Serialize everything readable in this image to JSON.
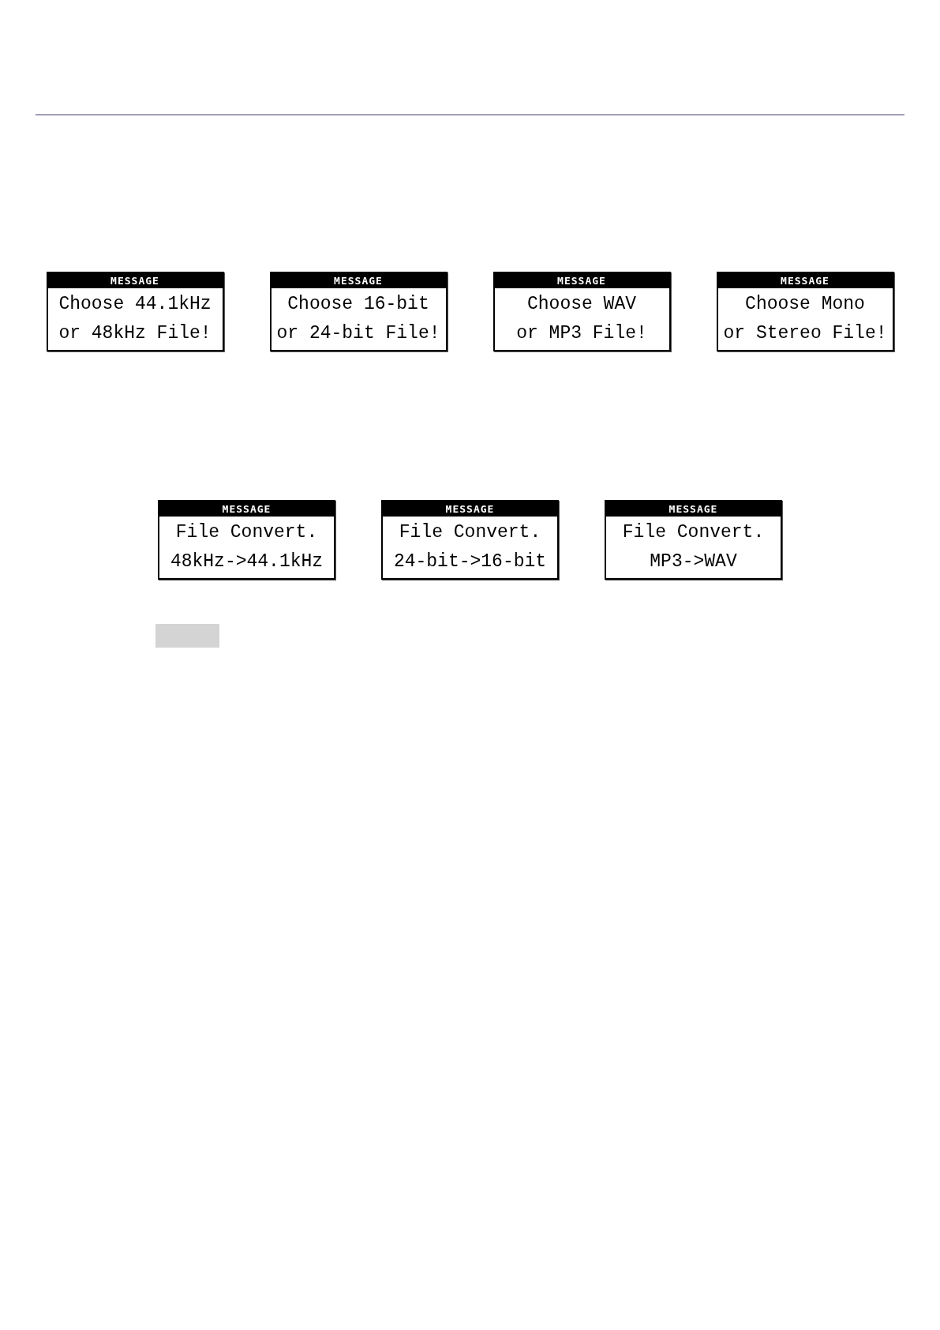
{
  "choice_messages": [
    {
      "title": "MESSAGE",
      "lines": [
        "Choose 44.1kHz",
        "or 48kHz File!"
      ]
    },
    {
      "title": "MESSAGE",
      "lines": [
        "Choose 16-bit",
        "or 24-bit File!"
      ]
    },
    {
      "title": "MESSAGE",
      "lines": [
        "Choose WAV",
        "or MP3 File!"
      ]
    },
    {
      "title": "MESSAGE",
      "lines": [
        "Choose Mono",
        "or Stereo File!"
      ]
    }
  ],
  "convert_messages": [
    {
      "title": "MESSAGE",
      "lines": [
        "File Convert.",
        "48kHz->44.1kHz"
      ]
    },
    {
      "title": "MESSAGE",
      "lines": [
        "File Convert.",
        "24-bit->16-bit"
      ]
    },
    {
      "title": "MESSAGE",
      "lines": [
        "File Convert.",
        "MP3->WAV"
      ]
    }
  ]
}
